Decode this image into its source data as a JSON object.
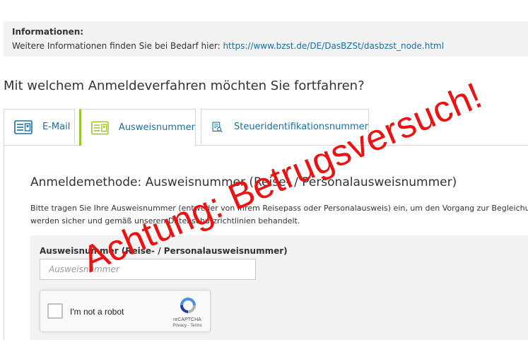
{
  "info": {
    "title": "Informationen:",
    "text": "Weitere Informationen finden Sie bei Bedarf hier: ",
    "link": "https://www.bzst.de/DE/DasBZSt/dasbzst_node.html"
  },
  "question": "Mit welchem Anmeldeverfahren möchten Sie fortfahren?",
  "tabs": [
    {
      "label": "E-Mail",
      "icon": "id-card-icon"
    },
    {
      "label": "Ausweisnummer",
      "icon": "id-card-icon",
      "active": true
    },
    {
      "label": "Steueridentifikationsnummer",
      "icon": "document-search-icon"
    }
  ],
  "method": {
    "title": "Anmeldemethode: Ausweisnummer (Reise- / Personalausweisnummer)",
    "desc_line1": "Bitte tragen Sie Ihre Ausweisnummer (entweder von Ihrem Reisepass oder Personalausweis) ein, um den Vorgang zur Begleichung d",
    "desc_line2": "werden sicher und gemäß unseren Datenschutzrichtlinien behandelt."
  },
  "form": {
    "field_label": "Ausweisnummer (Reise- / Personalausweisnummer)",
    "placeholder": "Ausweisnummer",
    "value": ""
  },
  "recaptcha": {
    "label": "I'm not a robot",
    "brand": "reCAPTCHA",
    "terms": "Privacy - Terms"
  },
  "warning": "Achtung: Betrugsversuch!",
  "colors": {
    "link": "#1a6fa3",
    "active_tab_accent": "#9cc42f",
    "warning": "#ee1111",
    "panel_bg": "#f3f3f3"
  }
}
